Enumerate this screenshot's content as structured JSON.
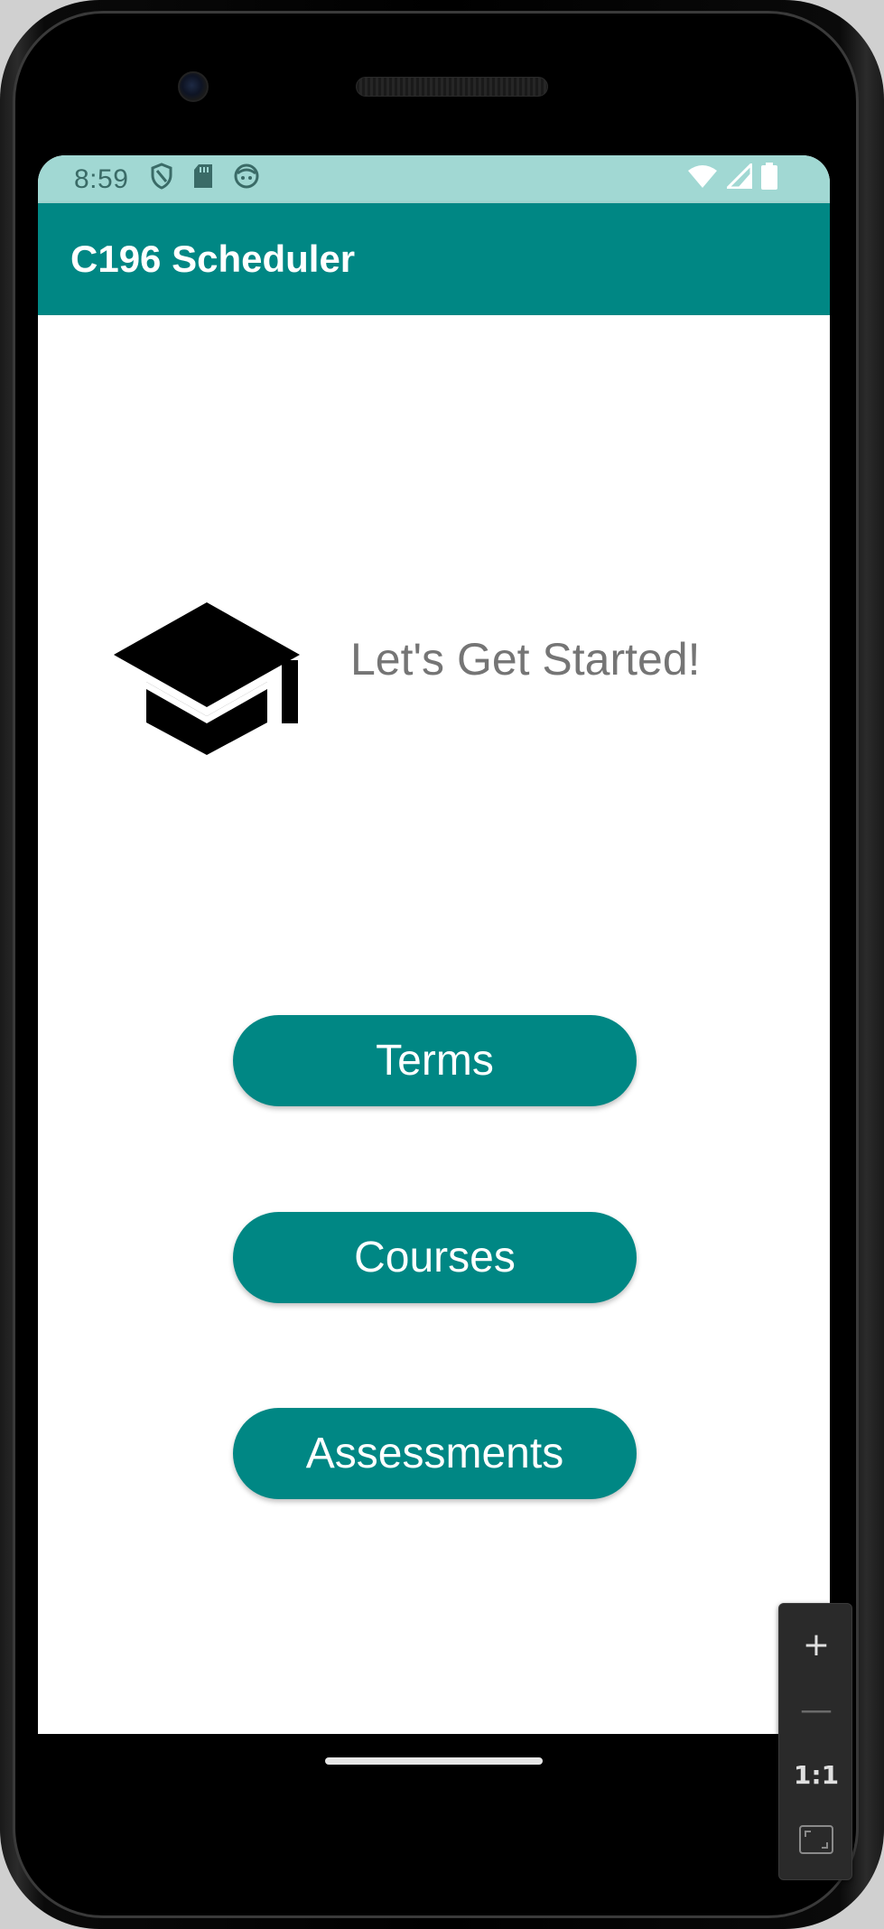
{
  "status_bar": {
    "time": "8:59",
    "left_icons": [
      "shield-icon",
      "sd-card-icon",
      "face-icon"
    ],
    "right_icons": [
      "wifi-icon",
      "cell-signal-icon",
      "battery-icon"
    ]
  },
  "app_bar": {
    "title": "C196 Scheduler"
  },
  "main": {
    "icon": "graduation-cap-icon",
    "headline": "Let's Get Started!",
    "buttons": [
      {
        "label": "Terms"
      },
      {
        "label": "Courses"
      },
      {
        "label": "Assessments"
      }
    ]
  },
  "zoom_controls": {
    "zoom_in": "+",
    "zoom_out": "—",
    "reset": "1:1"
  },
  "colors": {
    "primary": "#008784",
    "status_bar": "#a1d8d3",
    "headline_text": "#757575",
    "screen_background": "#ffffff"
  }
}
